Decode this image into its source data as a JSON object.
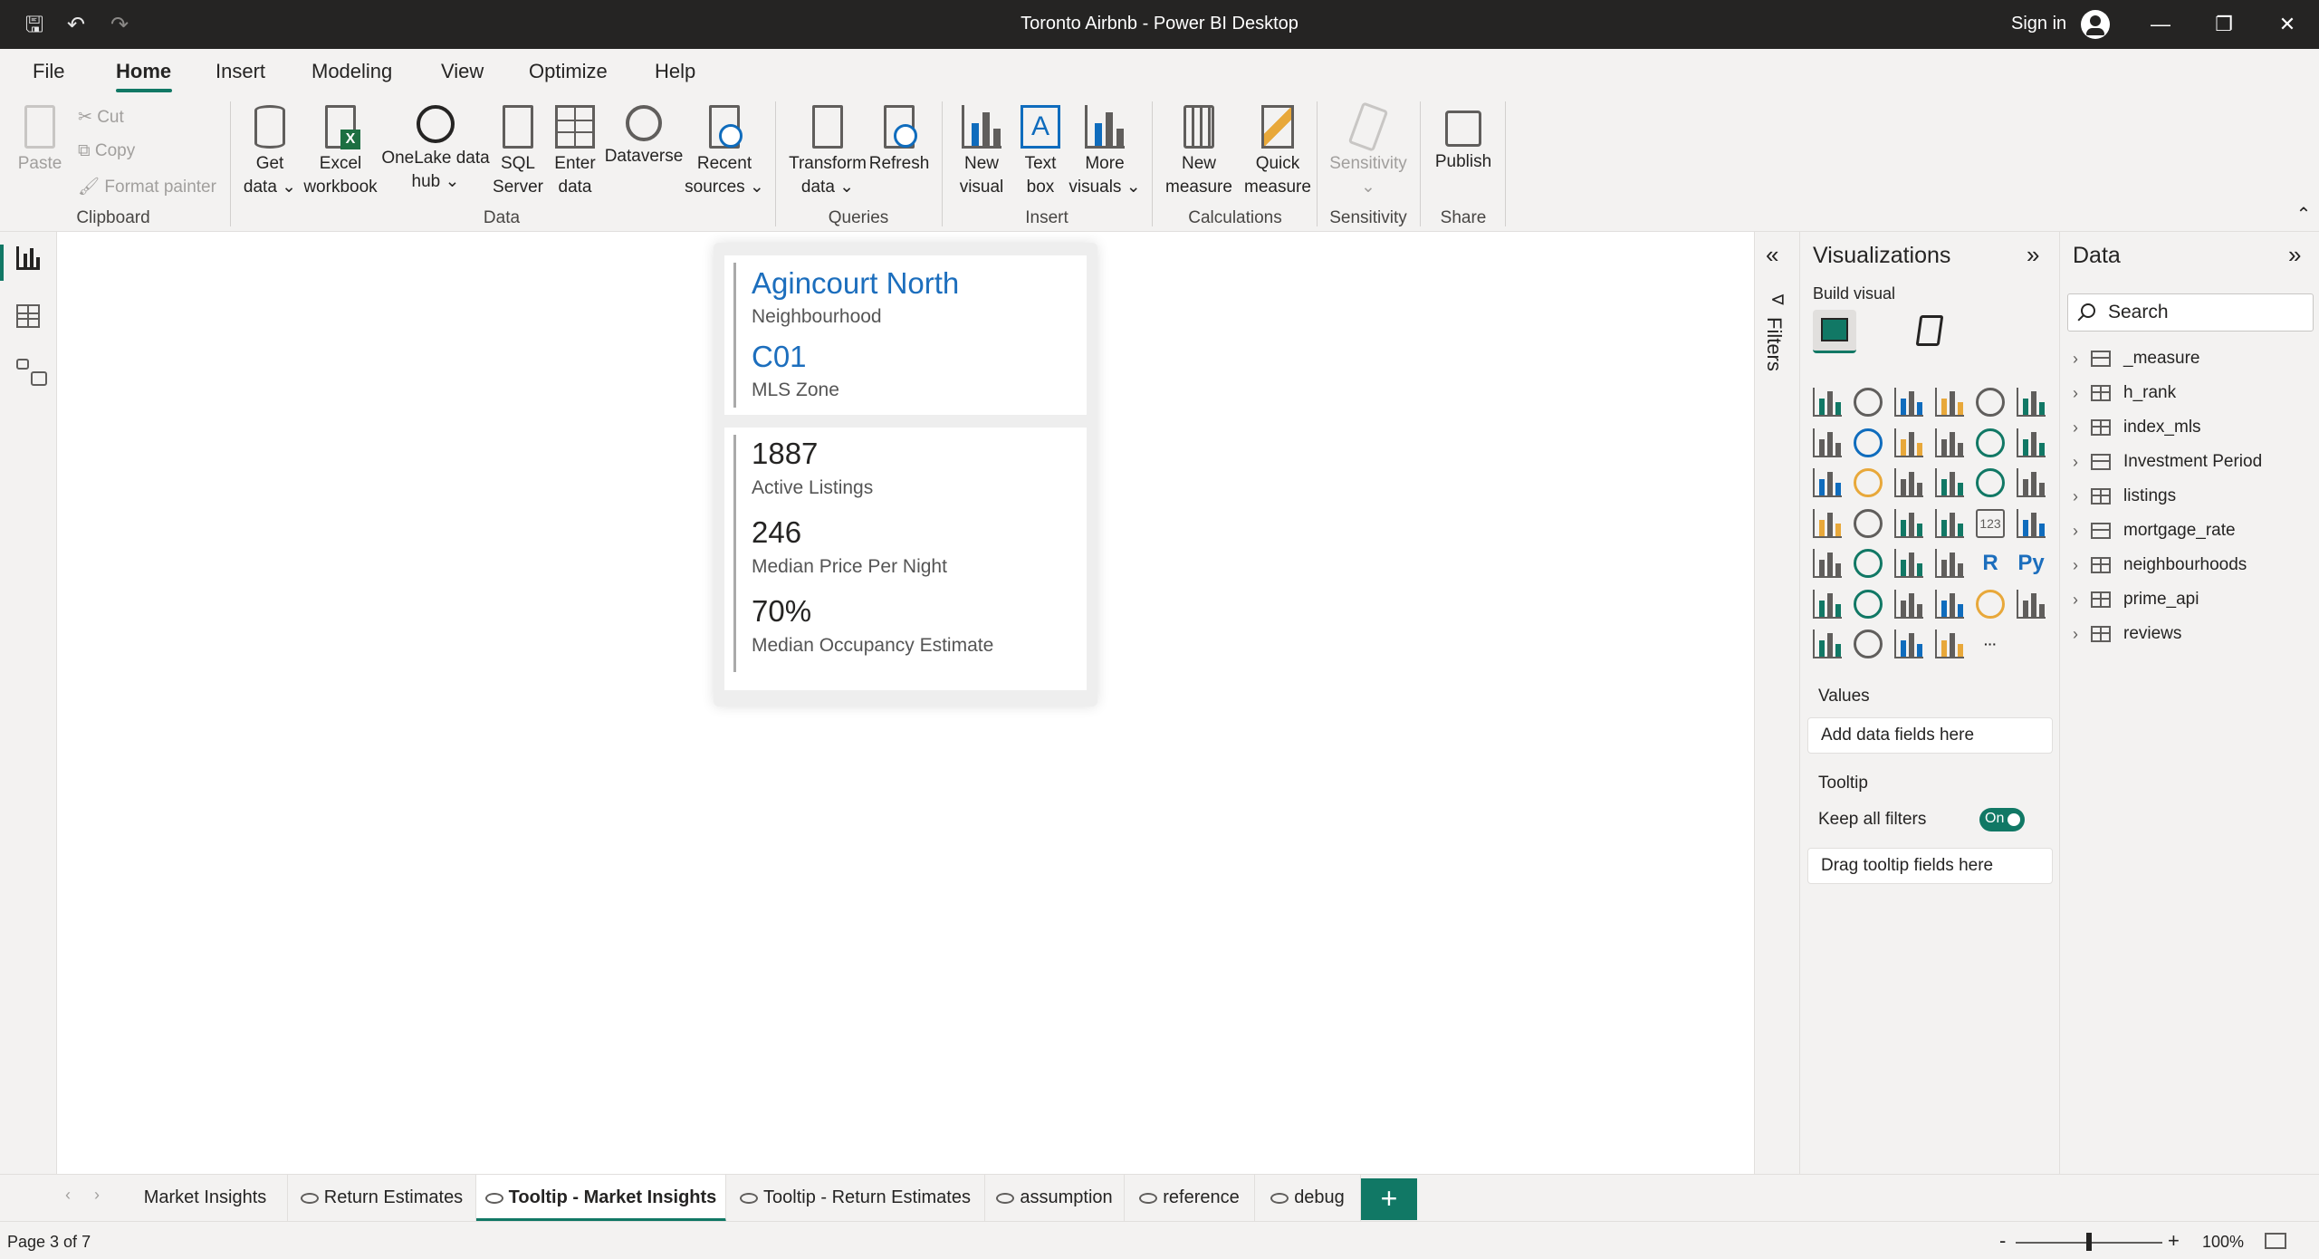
{
  "window": {
    "title": "Toronto Airbnb - Power BI Desktop",
    "sign_in": "Sign in",
    "minimize": "—",
    "restore": "❐",
    "close": "✕"
  },
  "quick_access": {
    "save": "🖫",
    "undo": "↶",
    "redo": "↷"
  },
  "menu": [
    "File",
    "Home",
    "Insert",
    "Modeling",
    "View",
    "Optimize",
    "Help"
  ],
  "menu_active": "Home",
  "ribbon": {
    "clipboard": {
      "paste": "Paste",
      "cut": "Cut",
      "copy": "Copy",
      "format_painter": "Format painter",
      "label": "Clipboard"
    },
    "data": {
      "get_data": [
        "Get",
        "data ⌄"
      ],
      "excel": [
        "Excel",
        "workbook"
      ],
      "onelake": [
        "OneLake data",
        "hub ⌄"
      ],
      "sql": [
        "SQL",
        "Server"
      ],
      "enter": [
        "Enter",
        "data"
      ],
      "dataverse": [
        "Dataverse"
      ],
      "recent": [
        "Recent",
        "sources ⌄"
      ],
      "label": "Data"
    },
    "queries": {
      "transform": [
        "Transform",
        "data ⌄"
      ],
      "refresh": [
        "Refresh"
      ],
      "label": "Queries"
    },
    "insert": {
      "new_visual": [
        "New",
        "visual"
      ],
      "text_box": [
        "Text",
        "box"
      ],
      "more_visuals": [
        "More",
        "visuals ⌄"
      ],
      "label": "Insert"
    },
    "calculations": {
      "new_measure": [
        "New",
        "measure"
      ],
      "quick_measure": [
        "Quick",
        "measure"
      ],
      "label": "Calculations"
    },
    "sensitivity": {
      "btn": [
        "Sensitivity",
        "⌄"
      ],
      "label": "Sensitivity"
    },
    "share": {
      "publish": [
        "Publish"
      ],
      "label": "Share"
    },
    "collapse": "⌃"
  },
  "report": {
    "neighbourhood_value": "Agincourt North",
    "neighbourhood_label": "Neighbourhood",
    "zone_value": "C01",
    "zone_label": "MLS Zone",
    "listings_value": "1887",
    "listings_label": "Active Listings",
    "price_value": "246",
    "price_label": "Median Price Per Night",
    "occupancy_value": "70%",
    "occupancy_label": "Median Occupancy Estimate"
  },
  "filters": {
    "label": "Filters",
    "collapse": "«",
    "funnel": "⊲"
  },
  "visualizations": {
    "title": "Visualizations",
    "expand": "»",
    "build_visual": "Build visual",
    "values_label": "Values",
    "values_placeholder": "Add data fields here",
    "tooltip_label": "Tooltip",
    "keep_filters_label": "Keep all filters",
    "keep_filters_toggle": "On",
    "tooltip_placeholder": "Drag tooltip fields here",
    "icons": [
      "stacked-bar",
      "clustered-column",
      "clustered-bar",
      "stacked-column",
      "100-bar",
      "100-column",
      "line",
      "area",
      "stacked-area",
      "line-column",
      "line-clustered-column",
      "ribbon",
      "waterfall",
      "funnel",
      "scatter",
      "pie",
      "donut",
      "treemap",
      "map",
      "filled-map",
      "azure-map",
      "gauge",
      "card",
      "multi-row-card",
      "kpi",
      "slicer",
      "table",
      "matrix",
      "r-visual",
      "python-visual",
      "key-influencers",
      "decomposition-tree",
      "qna",
      "smart-narrative",
      "goals",
      "paginated",
      "power-apps",
      "power-automate",
      "diamond-visual",
      "chevron-visual",
      "more"
    ],
    "text_icons": {
      "r-visual": "R",
      "python-visual": "Py",
      "card": "123",
      "more": "···"
    }
  },
  "data_pane": {
    "title": "Data",
    "expand": "»",
    "search_placeholder": "Search",
    "tables": [
      {
        "name": "_measure",
        "kind": "measure"
      },
      {
        "name": "h_rank",
        "kind": "table"
      },
      {
        "name": "index_mls",
        "kind": "table"
      },
      {
        "name": "Investment Period",
        "kind": "measure"
      },
      {
        "name": "listings",
        "kind": "table"
      },
      {
        "name": "mortgage_rate",
        "kind": "measure"
      },
      {
        "name": "neighbourhoods",
        "kind": "table"
      },
      {
        "name": "prime_api",
        "kind": "table"
      },
      {
        "name": "reviews",
        "kind": "table"
      }
    ]
  },
  "pages": {
    "prev": "‹",
    "next": "›",
    "tabs": [
      {
        "label": "Market Insights",
        "hidden": false,
        "active": false
      },
      {
        "label": "Return Estimates",
        "hidden": true,
        "active": false
      },
      {
        "label": "Tooltip - Market Insights",
        "hidden": true,
        "active": true
      },
      {
        "label": "Tooltip - Return Estimates",
        "hidden": true,
        "active": false
      },
      {
        "label": "assumption",
        "hidden": true,
        "active": false
      },
      {
        "label": "reference",
        "hidden": true,
        "active": false
      },
      {
        "label": "debug",
        "hidden": true,
        "active": false
      }
    ],
    "add": "+"
  },
  "status": {
    "page_indicator": "Page 3 of 7",
    "zoom_out": "-",
    "zoom_in": "+",
    "zoom": "100%",
    "zoom_level": 0.5
  }
}
